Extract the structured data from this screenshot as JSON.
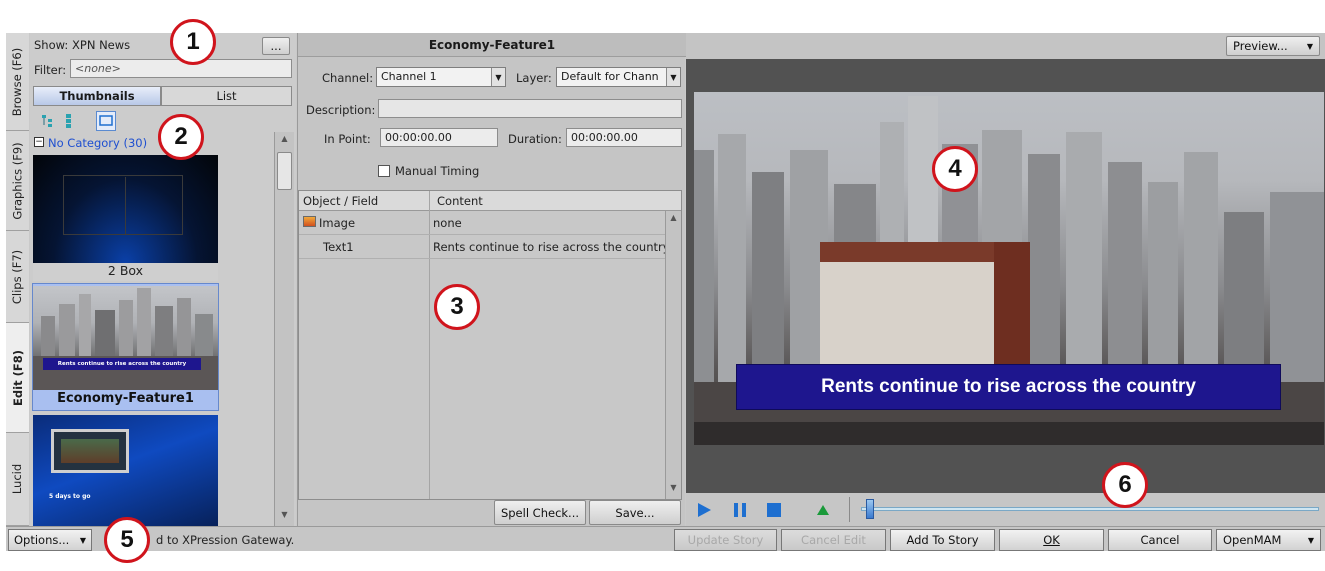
{
  "left": {
    "show_label": "Show:",
    "show_value": "XPN News",
    "browse_button": "...",
    "filter_label": "Filter:",
    "filter_placeholder": "<none>",
    "tabs": [
      "Thumbnails",
      "List"
    ],
    "category": "No Category (30)",
    "items": [
      {
        "caption": "2 Box"
      },
      {
        "caption": "Economy-Feature1",
        "overlay": "Rents continue to rise across the country"
      },
      {
        "caption": "",
        "overlay": "5 days to go"
      }
    ]
  },
  "vtabs": [
    "Browse (F6)",
    "Graphics (F9)",
    "Clips (F7)",
    "Edit (F8)",
    "Lucid"
  ],
  "editor": {
    "title": "Economy-Feature1",
    "channel_label": "Channel:",
    "channel_value": "Channel 1",
    "layer_label": "Layer:",
    "layer_value": "Default for Chann",
    "description_label": "Description:",
    "description_value": "",
    "inpoint_label": "In Point:",
    "inpoint_value": "00:00:00.00",
    "duration_label": "Duration:",
    "duration_value": "00:00:00.00",
    "manual_timing": "Manual Timing",
    "headers": [
      "Object / Field",
      "Content"
    ],
    "rows": [
      {
        "field": "Image",
        "content": "none"
      },
      {
        "field": "Text1",
        "content": "Rents continue to rise across the country"
      }
    ],
    "spell_check": "Spell Check...",
    "save": "Save..."
  },
  "preview": {
    "mode": "Preview...",
    "lower_third": "Rents continue to rise across the country",
    "scrub_position": 0.01
  },
  "bottom": {
    "options": "Options...",
    "status": "d to XPression Gateway.",
    "buttons": [
      "Update Story",
      "Cancel Edit",
      "Add To Story",
      "OK",
      "Cancel",
      "OpenMAM"
    ]
  },
  "callouts": [
    "1",
    "2",
    "3",
    "4",
    "5",
    "6"
  ],
  "colors": {
    "accent": "#1e6fd0",
    "lowerthird": "#1e168e",
    "callout_ring": "#d0141c"
  }
}
